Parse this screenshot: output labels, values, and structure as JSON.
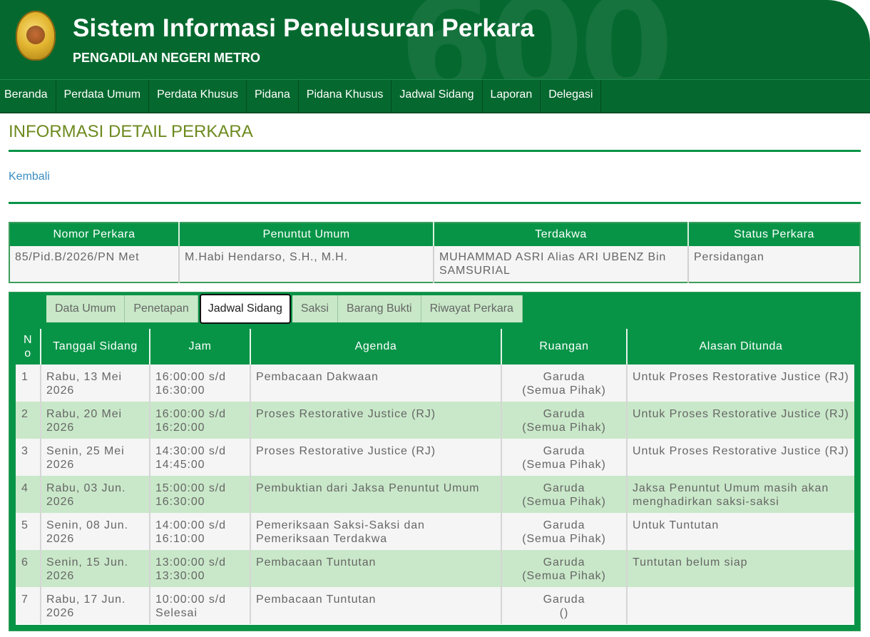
{
  "header": {
    "title": "Sistem Informasi Penelusuran Perkara",
    "subtitle": "PENGADILAN NEGERI METRO",
    "brand_color": "#05692f"
  },
  "nav": [
    "Beranda",
    "Perdata Umum",
    "Perdata Khusus",
    "Pidana",
    "Pidana Khusus",
    "Jadwal Sidang",
    "Laporan",
    "Delegasi"
  ],
  "page_title": "INFORMASI DETAIL PERKARA",
  "back_label": "Kembali",
  "summary": {
    "headers": [
      "Nomor Perkara",
      "Penuntut Umum",
      "Terdakwa",
      "Status Perkara"
    ],
    "row": [
      "85/Pid.B/2026/PN Met",
      "M.Habi Hendarso, S.H., M.H.",
      "MUHAMMAD ASRI Alias ARI UBENZ Bin SAMSURIAL",
      "Persidangan"
    ]
  },
  "tabs": [
    "Data Umum",
    "Penetapan",
    "Jadwal Sidang",
    "Saksi",
    "Barang Bukti",
    "Riwayat Perkara"
  ],
  "active_tab": "Jadwal Sidang",
  "schedule": {
    "headers": [
      "N o",
      "Tanggal Sidang",
      "Jam",
      "Agenda",
      "Ruangan",
      "Alasan Ditunda"
    ],
    "rows": [
      {
        "no": "1",
        "tanggal": "Rabu, 13 Mei 2026",
        "jam": "16:00:00 s/d 16:30:00",
        "agenda": "Pembacaan Dakwaan",
        "ruangan": "Garuda",
        "pihak": "(Semua Pihak)",
        "alasan": "Untuk Proses Restorative Justice (RJ)"
      },
      {
        "no": "2",
        "tanggal": "Rabu, 20 Mei 2026",
        "jam": "16:00:00 s/d 16:20:00",
        "agenda": "Proses Restorative Justice (RJ)",
        "ruangan": "Garuda",
        "pihak": "(Semua Pihak)",
        "alasan": "Untuk Proses Restorative Justice (RJ)"
      },
      {
        "no": "3",
        "tanggal": "Senin, 25 Mei 2026",
        "jam": "14:30:00 s/d 14:45:00",
        "agenda": "Proses Restorative Justice (RJ)",
        "ruangan": "Garuda",
        "pihak": "(Semua Pihak)",
        "alasan": "Untuk Proses Restorative Justice (RJ)"
      },
      {
        "no": "4",
        "tanggal": "Rabu, 03 Jun. 2026",
        "jam": "15:00:00 s/d 16:30:00",
        "agenda": "Pembuktian dari Jaksa Penuntut Umum",
        "ruangan": "Garuda",
        "pihak": "(Semua Pihak)",
        "alasan": "Jaksa Penuntut Umum masih akan menghadirkan saksi-saksi"
      },
      {
        "no": "5",
        "tanggal": "Senin, 08 Jun. 2026",
        "jam": "14:00:00 s/d 16:10:00",
        "agenda": "Pemeriksaan Saksi-Saksi dan Pemeriksaan Terdakwa",
        "ruangan": "Garuda",
        "pihak": "(Semua Pihak)",
        "alasan": "Untuk Tuntutan"
      },
      {
        "no": "6",
        "tanggal": "Senin, 15 Jun. 2026",
        "jam": "13:00:00 s/d 13:30:00",
        "agenda": "Pembacaan Tuntutan",
        "ruangan": "Garuda",
        "pihak": "(Semua Pihak)",
        "alasan": "Tuntutan belum siap"
      },
      {
        "no": "7",
        "tanggal": "Rabu, 17 Jun. 2026",
        "jam": "10:00:00 s/d Selesai",
        "agenda": "Pembacaan Tuntutan",
        "ruangan": "Garuda",
        "pihak": "()",
        "alasan": ""
      }
    ]
  }
}
